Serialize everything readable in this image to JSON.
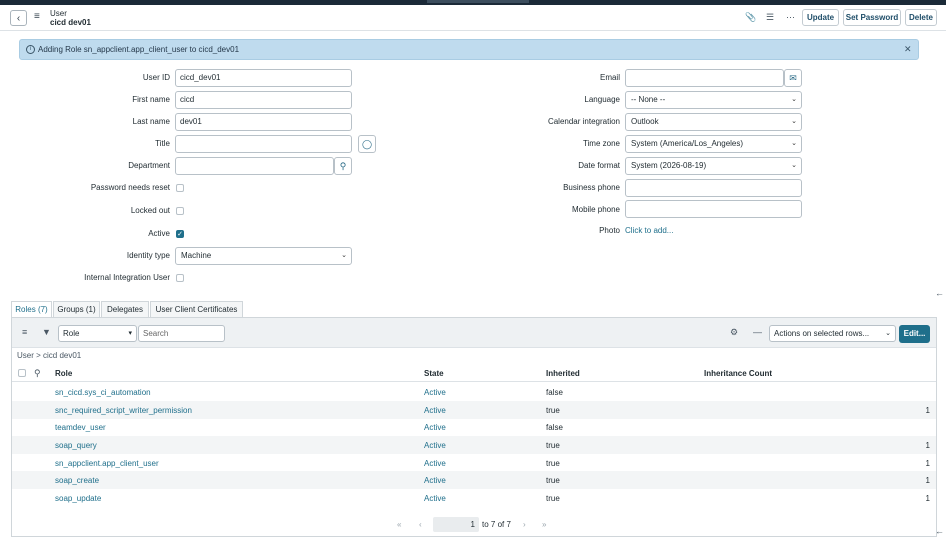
{
  "header": {
    "record_type": "User",
    "record_name": "cicd dev01",
    "buttons": {
      "update": "Update",
      "set_password": "Set Password",
      "delete": "Delete"
    }
  },
  "banner": {
    "message": "Adding Role sn_appclient.app_client_user to cicd_dev01"
  },
  "form": {
    "left": [
      {
        "label": "User ID",
        "value": "cicd_dev01"
      },
      {
        "label": "First name",
        "value": "cicd"
      },
      {
        "label": "Last name",
        "value": "dev01"
      },
      {
        "label": "Title",
        "value": ""
      },
      {
        "label": "Department",
        "value": ""
      },
      {
        "label": "Password needs reset",
        "checked": false
      },
      {
        "label": "Locked out",
        "checked": false
      },
      {
        "label": "Active",
        "checked": true
      },
      {
        "label": "Identity type",
        "value": "Machine"
      },
      {
        "label": "Internal Integration User",
        "checked": false
      }
    ],
    "right": [
      {
        "label": "Email",
        "value": ""
      },
      {
        "label": "Language",
        "value": "-- None --"
      },
      {
        "label": "Calendar integration",
        "value": "Outlook"
      },
      {
        "label": "Time zone",
        "value": "System (America/Los_Angeles)"
      },
      {
        "label": "Date format",
        "value": "System (2026-08-19)"
      },
      {
        "label": "Business phone",
        "value": ""
      },
      {
        "label": "Mobile phone",
        "value": ""
      },
      {
        "label": "Photo",
        "value": "Click to add..."
      }
    ]
  },
  "tabs": [
    "Roles (7)",
    "Groups (1)",
    "Delegates",
    "User Client Certificates"
  ],
  "list": {
    "filter_field": "Role",
    "search_placeholder": "Search",
    "actions_placeholder": "Actions on selected rows...",
    "edit_label": "Edit...",
    "breadcrumb": "User > cicd dev01",
    "columns": [
      "Role",
      "State",
      "Inherited",
      "Inheritance Count"
    ],
    "rows": [
      {
        "role": "sn_cicd.sys_ci_automation",
        "state": "Active",
        "inherited": "false",
        "count": ""
      },
      {
        "role": "snc_required_script_writer_permission",
        "state": "Active",
        "inherited": "true",
        "count": "1"
      },
      {
        "role": "teamdev_user",
        "state": "Active",
        "inherited": "false",
        "count": ""
      },
      {
        "role": "soap_query",
        "state": "Active",
        "inherited": "true",
        "count": "1"
      },
      {
        "role": "sn_appclient.app_client_user",
        "state": "Active",
        "inherited": "true",
        "count": "1"
      },
      {
        "role": "soap_create",
        "state": "Active",
        "inherited": "true",
        "count": "1"
      },
      {
        "role": "soap_update",
        "state": "Active",
        "inherited": "true",
        "count": "1"
      }
    ],
    "pager": {
      "current": "1",
      "text": "to 7 of 7"
    }
  }
}
